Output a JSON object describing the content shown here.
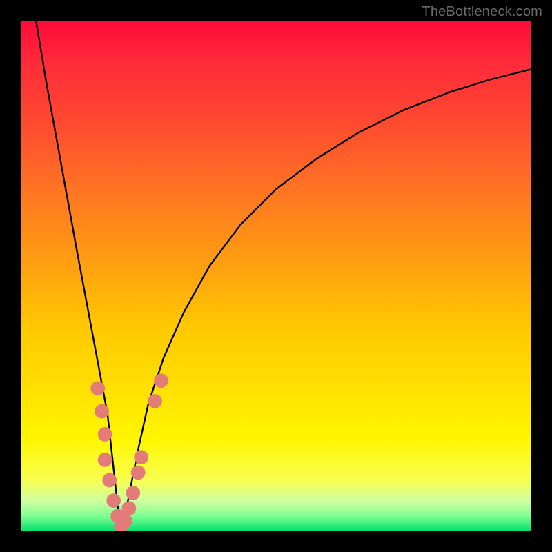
{
  "watermark": "TheBottleneck.com",
  "chart_data": {
    "type": "line",
    "title": "",
    "xlabel": "",
    "ylabel": "",
    "xlim": [
      0,
      100
    ],
    "ylim": [
      0,
      100
    ],
    "grid": false,
    "legend": false,
    "y_gradient_stops": [
      {
        "pct": 0,
        "color": "#ff0a3a"
      },
      {
        "pct": 8,
        "color": "#ff2a3a"
      },
      {
        "pct": 20,
        "color": "#ff4a30"
      },
      {
        "pct": 35,
        "color": "#ff7a20"
      },
      {
        "pct": 48,
        "color": "#ffa010"
      },
      {
        "pct": 60,
        "color": "#ffc800"
      },
      {
        "pct": 72,
        "color": "#ffe000"
      },
      {
        "pct": 82,
        "color": "#fff600"
      },
      {
        "pct": 90,
        "color": "#f8ff50"
      },
      {
        "pct": 94,
        "color": "#d0ffa0"
      },
      {
        "pct": 97,
        "color": "#80ff90"
      },
      {
        "pct": 100,
        "color": "#00e070"
      }
    ],
    "series": [
      {
        "name": "bottleneck-curve",
        "color": "#000000",
        "x": [
          3,
          5,
          7,
          9,
          11,
          12.5,
          14,
          15.5,
          17,
          18,
          19,
          19.7,
          21,
          23,
          25,
          28,
          32,
          37,
          43,
          50,
          58,
          66,
          75,
          84,
          92,
          98,
          100
        ],
        "y": [
          100,
          88,
          77,
          66,
          55,
          47,
          39,
          31,
          23,
          14,
          5,
          0,
          6,
          16,
          25,
          34,
          43,
          52,
          60,
          67,
          73,
          78,
          82.5,
          86,
          88.5,
          90,
          90.5
        ]
      }
    ],
    "marker_series": [
      {
        "name": "gpu-markers",
        "color": "#e37b78",
        "radius_pct": 1.4,
        "points": [
          {
            "x": 15.1,
            "y": 28.0
          },
          {
            "x": 15.9,
            "y": 23.5
          },
          {
            "x": 16.5,
            "y": 19.0
          },
          {
            "x": 16.5,
            "y": 14.0
          },
          {
            "x": 17.4,
            "y": 10.0
          },
          {
            "x": 18.2,
            "y": 6.0
          },
          {
            "x": 19.0,
            "y": 3.0
          },
          {
            "x": 19.7,
            "y": 1.0
          },
          {
            "x": 20.5,
            "y": 2.0
          },
          {
            "x": 21.2,
            "y": 4.5
          },
          {
            "x": 22.0,
            "y": 7.5
          },
          {
            "x": 23.0,
            "y": 11.5
          },
          {
            "x": 23.6,
            "y": 14.5
          },
          {
            "x": 26.3,
            "y": 25.5
          },
          {
            "x": 27.5,
            "y": 29.5
          }
        ]
      }
    ]
  }
}
